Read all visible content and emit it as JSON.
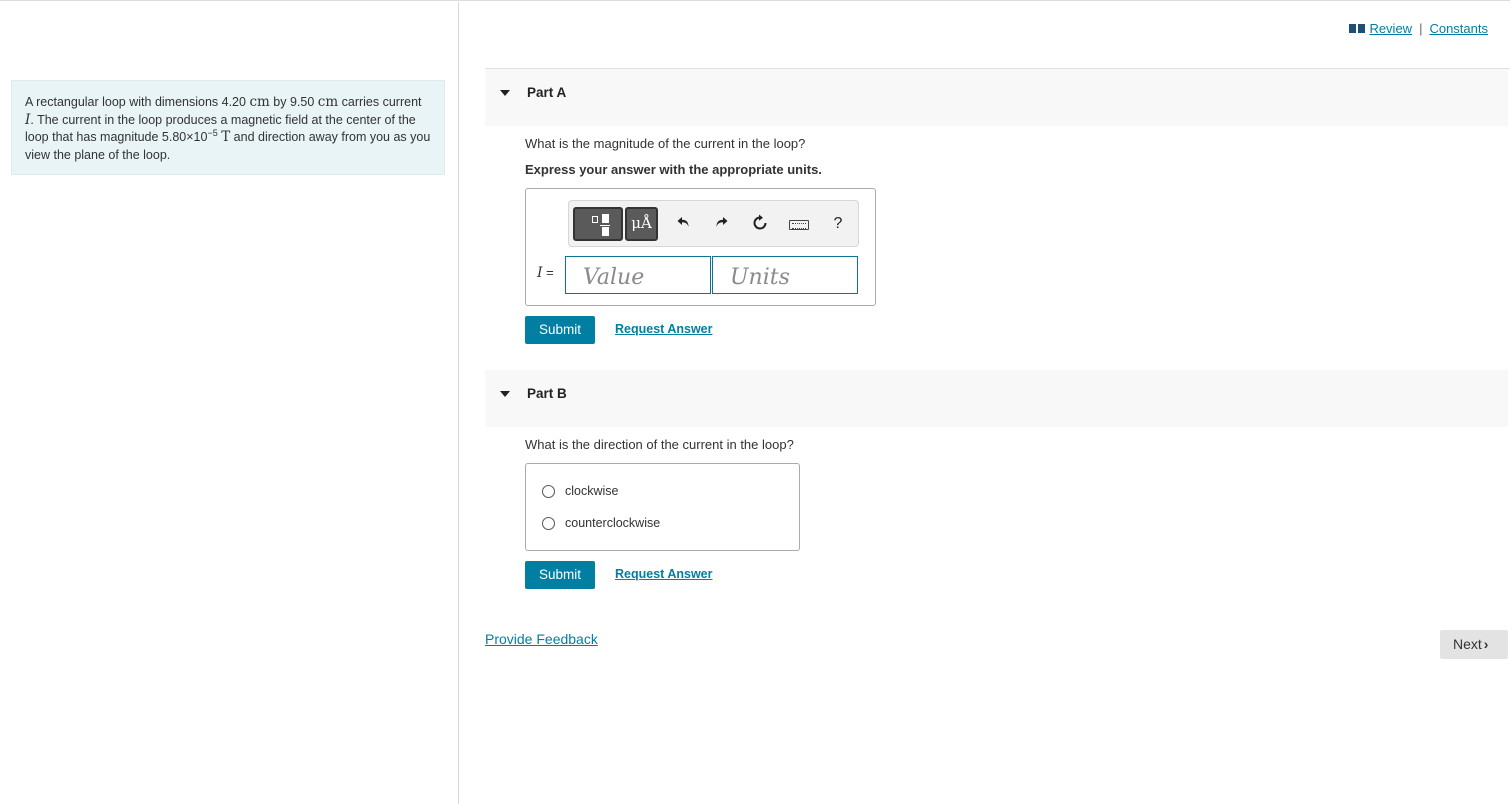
{
  "problem": {
    "p1": "A rectangular loop with dimensions 4.20 ",
    "u1": "cm",
    "p2": " by 9.50 ",
    "u2": "cm",
    "p3": " carries current ",
    "var": "I",
    "p4": ". The current in the loop produces a magnetic field at the center of the loop that has magnitude 5.80×10",
    "exp": "−5",
    "u3": "T",
    "p5": " and direction away from you as you view the plane of the loop."
  },
  "header": {
    "review": "Review",
    "separator": "|",
    "constants": "Constants"
  },
  "partA": {
    "label": "Part A",
    "question": "What is the magnitude of the current in the loop?",
    "instruction": "Express your answer with the appropriate units.",
    "toolbar": {
      "units_button": "μÅ",
      "help": "?",
      "icons": [
        "templates-icon",
        "units-icon",
        "undo-icon",
        "redo-icon",
        "reset-icon",
        "keyboard-icon",
        "help-icon"
      ]
    },
    "variable": "I",
    "equals": " =",
    "value_placeholder": "Value",
    "units_placeholder": "Units",
    "submit": "Submit",
    "request": "Request Answer"
  },
  "partB": {
    "label": "Part B",
    "question": "What is the direction of the current in the loop?",
    "options": [
      "clockwise",
      "counterclockwise"
    ],
    "submit": "Submit",
    "request": "Request Answer"
  },
  "footer": {
    "feedback": "Provide Feedback",
    "next": "Next",
    "next_icon": "›"
  },
  "colors": {
    "accent": "#007fa3",
    "problem_bg": "#e8f4f6",
    "part_header_bg": "#f8f8f8"
  }
}
